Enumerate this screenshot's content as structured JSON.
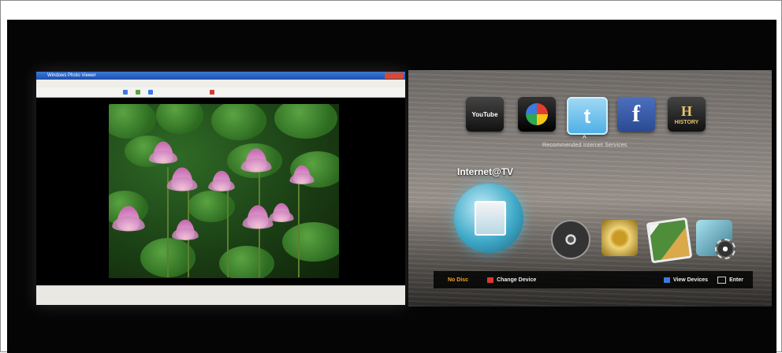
{
  "pc_window": {
    "title": "Windows Photo Viewer"
  },
  "tv_menu": {
    "apps": [
      {
        "name": "youtube-icon",
        "label": "YouTube"
      },
      {
        "name": "picasa-icon",
        "label": ""
      },
      {
        "name": "twitter-icon",
        "label": "t"
      },
      {
        "name": "facebook-icon",
        "label": "f"
      },
      {
        "name": "history-icon",
        "label": "HISTORY"
      }
    ],
    "recommended_label": "Recommended Internet Services",
    "internet_tv_label": "Internet@TV",
    "bottom_bar": {
      "no_disc": "No Disc",
      "change_device": "Change Device",
      "view_devices": "View Devices",
      "enter": "Enter"
    }
  },
  "colors": {
    "background": "#050505",
    "no_disc": "#f0a326",
    "red_button": "#d93a2f",
    "blue_button": "#3b7ae0"
  }
}
